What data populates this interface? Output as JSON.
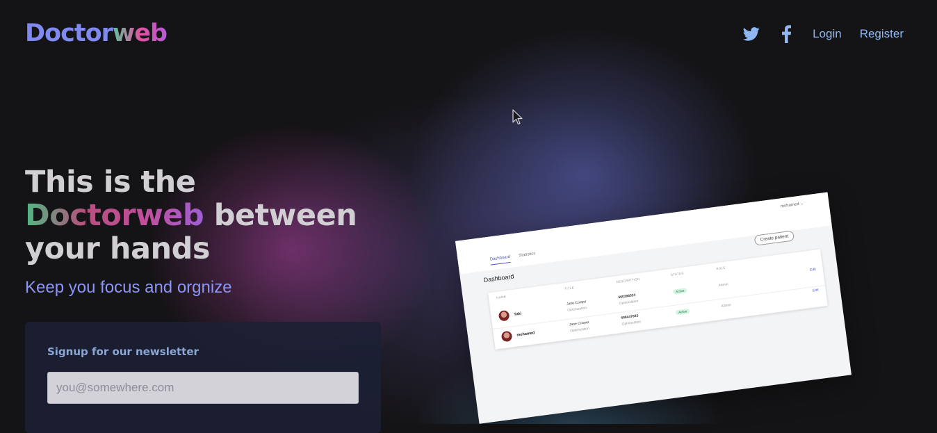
{
  "header": {
    "logo_part1": "Doctor",
    "logo_part2": "web",
    "nav": {
      "login": "Login",
      "register": "Register"
    },
    "icons": [
      "twitter-icon",
      "facebook-icon"
    ]
  },
  "hero": {
    "title_line1": "This is the",
    "title_brand": "Doctorweb",
    "title_between": "between",
    "title_line3": "your hands",
    "subtitle": "Keep you focus and orgnize"
  },
  "newsletter": {
    "heading": "Signup for our newsletter",
    "placeholder": "you@somewhere.com"
  },
  "preview": {
    "user": "mohamed ⌄",
    "tabs": [
      "Dashboard",
      "Statistics"
    ],
    "title": "Dashboard",
    "create_button": "Create patient",
    "columns": [
      "NAME",
      "TITLE",
      "DESCRIPTION",
      "STATUS",
      "ROLE"
    ],
    "rows": [
      {
        "name": "Taki",
        "title": "Jane Cooper",
        "title_sub": "Optimization",
        "description": "660396524",
        "description_sub": "Optimization",
        "status": "Active",
        "role": "Admin",
        "action": "Edit"
      },
      {
        "name": "mohamed",
        "title": "Jane Cooper",
        "title_sub": "Optimization",
        "description": "698447683",
        "description_sub": "Optimization",
        "status": "Active",
        "role": "Admin",
        "action": "Edit"
      }
    ]
  },
  "colors": {
    "background": "#141315",
    "logo_primary": "#7f89ef",
    "nav_link": "#8fb8f3",
    "subtitle": "#8d95f5",
    "newsletter_heading": "#8ca7d3"
  }
}
